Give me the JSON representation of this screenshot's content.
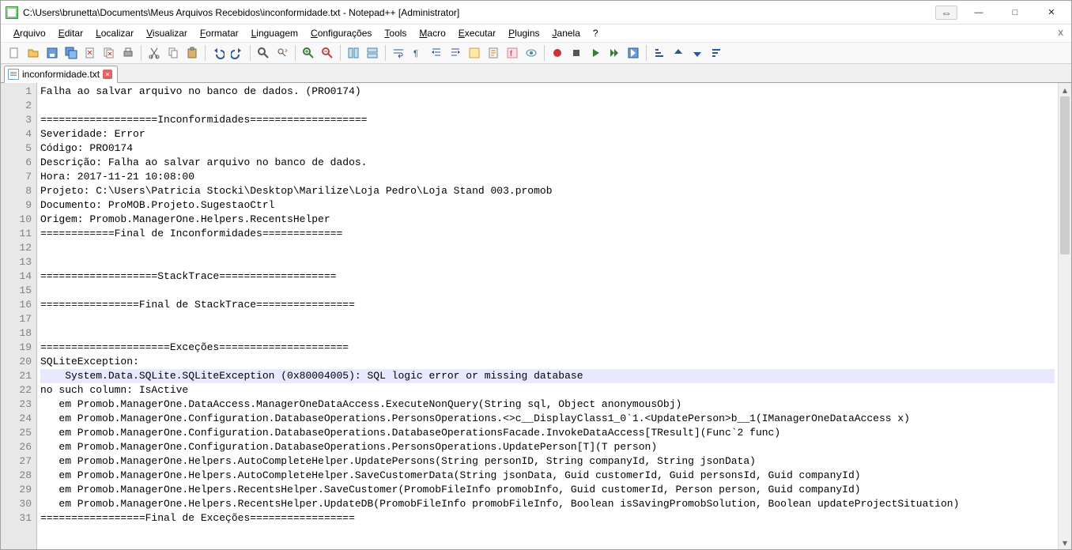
{
  "window": {
    "title": "C:\\Users\\brunetta\\Documents\\Meus Arquivos Recebidos\\inconformidade.txt - Notepad++ [Administrator]"
  },
  "menu": {
    "items": [
      {
        "label": "Arquivo",
        "ul": "A"
      },
      {
        "label": "Editar",
        "ul": "E"
      },
      {
        "label": "Localizar",
        "ul": "L"
      },
      {
        "label": "Visualizar",
        "ul": "V"
      },
      {
        "label": "Formatar",
        "ul": "F"
      },
      {
        "label": "Linguagem",
        "ul": "L"
      },
      {
        "label": "Configurações",
        "ul": "C"
      },
      {
        "label": "Tools",
        "ul": "T"
      },
      {
        "label": "Macro",
        "ul": "M"
      },
      {
        "label": "Executar",
        "ul": "E"
      },
      {
        "label": "Plugins",
        "ul": "P"
      },
      {
        "label": "Janela",
        "ul": "J"
      },
      {
        "label": "?",
        "ul": "?"
      }
    ]
  },
  "toolbar_names": [
    "new-file",
    "open-file",
    "save",
    "save-all",
    "close",
    "close-all",
    "print",
    "cut",
    "copy",
    "paste",
    "undo",
    "redo",
    "find",
    "replace",
    "zoom-in",
    "zoom-out",
    "sync-v",
    "sync-h",
    "word-wrap",
    "show-all",
    "indent-guide",
    "outdent-guide",
    "folder-tree",
    "doc-map",
    "func-list",
    "monitor",
    "record-macro",
    "stop-macro",
    "play-macro",
    "play-multi",
    "save-macro",
    "sort-asc",
    "up",
    "down",
    "sort-desc"
  ],
  "tab": {
    "filename": "inconformidade.txt"
  },
  "lines": [
    "Falha ao salvar arquivo no banco de dados. (PRO0174)",
    "",
    "===================Inconformidades===================",
    "Severidade: Error",
    "Código: PRO0174",
    "Descrição: Falha ao salvar arquivo no banco de dados.",
    "Hora: 2017-11-21 10:08:00",
    "Projeto: C:\\Users\\Patricia Stocki\\Desktop\\Marilize\\Loja Pedro\\Loja Stand 003.promob",
    "Documento: ProMOB.Projeto.SugestaoCtrl",
    "Origem: Promob.ManagerOne.Helpers.RecentsHelper",
    "============Final de Inconformidades=============",
    "",
    "",
    "===================StackTrace===================",
    "",
    "================Final de StackTrace================",
    "",
    "",
    "=====================Exceções=====================",
    "SQLiteException:",
    "    System.Data.SQLite.SQLiteException (0x80004005): SQL logic error or missing database",
    "no such column: IsActive",
    "   em Promob.ManagerOne.DataAccess.ManagerOneDataAccess.ExecuteNonQuery(String sql, Object anonymousObj)",
    "   em Promob.ManagerOne.Configuration.DatabaseOperations.PersonsOperations.<>c__DisplayClass1_0`1.<UpdatePerson>b__1(IManagerOneDataAccess x)",
    "   em Promob.ManagerOne.Configuration.DatabaseOperations.DatabaseOperationsFacade.InvokeDataAccess[TResult](Func`2 func)",
    "   em Promob.ManagerOne.Configuration.DatabaseOperations.PersonsOperations.UpdatePerson[T](T person)",
    "   em Promob.ManagerOne.Helpers.AutoCompleteHelper.UpdatePersons(String personID, String companyId, String jsonData)",
    "   em Promob.ManagerOne.Helpers.AutoCompleteHelper.SaveCustomerData(String jsonData, Guid customerId, Guid personsId, Guid companyId)",
    "   em Promob.ManagerOne.Helpers.RecentsHelper.SaveCustomer(PromobFileInfo promobInfo, Guid customerId, Person person, Guid companyId)",
    "   em Promob.ManagerOne.Helpers.RecentsHelper.UpdateDB(PromobFileInfo promobFileInfo, Boolean isSavingPromobSolution, Boolean updateProjectSituation)",
    "=================Final de Exceções================="
  ],
  "highlight_line": 21,
  "colors": {
    "gutter_bg": "#e8e8e8",
    "gutter_fg": "#808080",
    "highlight": "#e8e8ff"
  }
}
